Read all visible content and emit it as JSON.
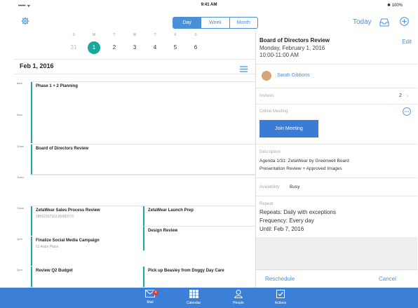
{
  "status_bar": {
    "carrier": "•••••  ᯤ",
    "time": "9:41 AM",
    "battery": "✱ 100%"
  },
  "toolbar": {
    "views": [
      {
        "label": "Day",
        "active": true
      },
      {
        "label": "Week",
        "active": false
      },
      {
        "label": "Month",
        "active": false
      }
    ],
    "today_label": "Today",
    "settings_icon": "gear-icon",
    "inbox_icon": "inbox-icon",
    "add_icon": "add-icon"
  },
  "week_strip": {
    "day_letters": [
      "S",
      "M",
      "T",
      "W",
      "T",
      "F",
      "S"
    ],
    "dates": [
      "31",
      "1",
      "2",
      "3",
      "4",
      "5",
      "6"
    ],
    "selected_index": 1
  },
  "date_header": "Feb 1, 2016",
  "timeline": {
    "hours": [
      "8am",
      "9am",
      "10am",
      "11am",
      "12pm",
      "1pm",
      "2pm"
    ],
    "events": [
      {
        "title": "Phase 1 + 2 Planning",
        "subtitle": ""
      },
      {
        "title": "Board of Directors Review",
        "subtitle": ""
      },
      {
        "title": "ZetaWear Sales Process Review",
        "subtitle": "18552337153,80383771"
      },
      {
        "title": "ZetaWear Launch Prep",
        "subtitle": ""
      },
      {
        "title": "Design Review",
        "subtitle": ""
      },
      {
        "title": "Finalize Social Media Campaign",
        "subtitle": "51 Astor Place"
      },
      {
        "title": "Review Q2 Budget",
        "subtitle": ""
      },
      {
        "title": "Pick up Beasley from Doggy Day Care",
        "subtitle": ""
      }
    ]
  },
  "detail": {
    "title": "Board of Directors Review",
    "date": "Monday, February 1, 2016",
    "time": "10:00-11:00 AM",
    "edit_label": "Edit",
    "organizer": "Sarah Gibbons",
    "invitees_label": "Invitees",
    "invitees_count": "2",
    "online_meeting_label": "Online Meeting",
    "join_label": "Join Meeting",
    "description_label": "Description",
    "description_line1": "Agenda 1/31: ZetaWear by Greenwell Board",
    "description_line2": "Presentation Review + Approved Images",
    "availability_label": "Availability:",
    "availability_value": "Busy",
    "repeat_label": "Repeat",
    "repeat_line1": "Repeats: Daily with exceptions",
    "repeat_line2": "Frequency: Every day",
    "repeat_line3": "Until: Feb 7, 2016",
    "reschedule_label": "Reschedule",
    "cancel_label": "Cancel"
  },
  "tab_bar": {
    "tabs": [
      {
        "label": "Mail",
        "icon": "mail-icon",
        "badge": "4"
      },
      {
        "label": "Calendar",
        "icon": "calendar-icon",
        "badge": ""
      },
      {
        "label": "People",
        "icon": "people-icon",
        "badge": ""
      },
      {
        "label": "Actions",
        "icon": "actions-icon",
        "badge": ""
      }
    ]
  },
  "colors": {
    "accent": "#4a90d9",
    "teal": "#1aa89a",
    "tabbar": "#3b80d6"
  }
}
